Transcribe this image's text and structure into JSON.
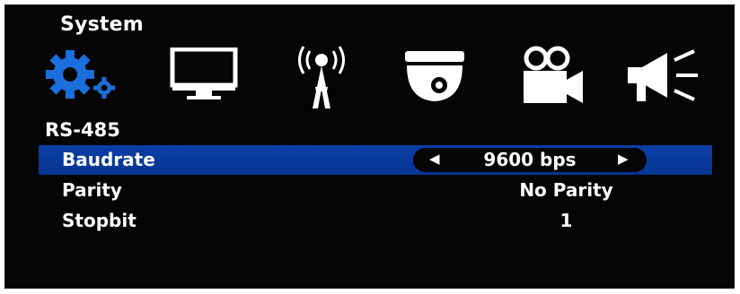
{
  "title": "System",
  "icons": [
    {
      "name": "gear-icon",
      "active": true
    },
    {
      "name": "monitor-icon",
      "active": false
    },
    {
      "name": "antenna-icon",
      "active": false
    },
    {
      "name": "dome-camera-icon",
      "active": false
    },
    {
      "name": "video-camera-icon",
      "active": false
    },
    {
      "name": "megaphone-icon",
      "active": false
    }
  ],
  "section": "RS-485",
  "rows": [
    {
      "label": "Baudrate",
      "value": "9600 bps",
      "selected": true
    },
    {
      "label": "Parity",
      "value": "No Parity",
      "selected": false
    },
    {
      "label": "Stopbit",
      "value": "1",
      "selected": false
    }
  ],
  "colors": {
    "active_icon": "#1a6fdc",
    "selection_bar": "#0a3fa7",
    "text": "#ffffff",
    "background": "#050505"
  }
}
